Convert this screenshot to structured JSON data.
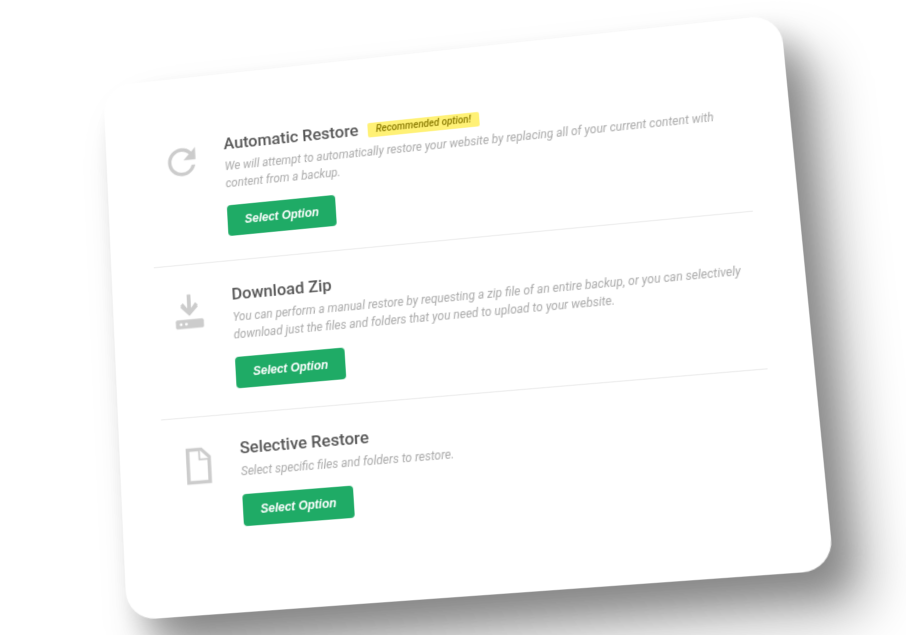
{
  "options": [
    {
      "title": "Automatic Restore",
      "badge": "Recommended option!",
      "description": "We will attempt to automatically restore your website by replacing all of your current content with content from a backup.",
      "button": "Select Option"
    },
    {
      "title": "Download Zip",
      "badge": null,
      "description": "You can perform a manual restore by requesting a zip file of an entire backup, or you can selectively download just the files and folders that you need to upload to your website.",
      "button": "Select Option"
    },
    {
      "title": "Selective Restore",
      "badge": null,
      "description": "Select specific files and folders to restore.",
      "button": "Select Option"
    }
  ]
}
